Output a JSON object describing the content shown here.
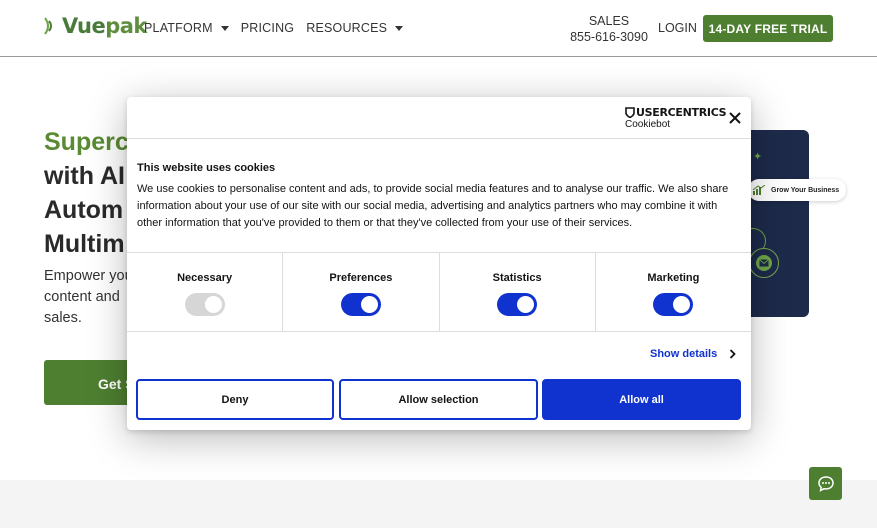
{
  "header": {
    "logo_text_vue": "Vue",
    "logo_text_pak": "pak",
    "nav": [
      {
        "label": "PLATFORM",
        "has_dropdown": true
      },
      {
        "label": "PRICING",
        "has_dropdown": false
      },
      {
        "label": "RESOURCES",
        "has_dropdown": true
      }
    ],
    "sales_label": "SALES",
    "sales_phone": "855-616-3090",
    "login_label": "LOGIN",
    "trial_label": "14-DAY FREE TRIAL"
  },
  "hero": {
    "title_line1": "Superc",
    "title_line2": "with AI",
    "title_line3": "Autom",
    "title_line4": "Multim",
    "sub_line1": "Empower you",
    "sub_line2": "content and",
    "sub_line3": "sales.",
    "cta_label": "Get S",
    "badge_label": "Grow Your Business"
  },
  "cookie_dialog": {
    "brand_top": "USERCENTRICS",
    "brand_sub": "Cookiebot",
    "heading": "This website uses cookies",
    "body": "We use cookies to personalise content and ads, to provide social media features and to analyse our traffic. We also share information about your use of our site with our social media, advertising and analytics partners who may combine it with other information that you've provided to them or that they've collected from your use of their services.",
    "categories": [
      {
        "label": "Necessary",
        "enabled": true,
        "locked": true
      },
      {
        "label": "Preferences",
        "enabled": true,
        "locked": false
      },
      {
        "label": "Statistics",
        "enabled": true,
        "locked": false
      },
      {
        "label": "Marketing",
        "enabled": true,
        "locked": false
      }
    ],
    "show_details": "Show details",
    "buttons": {
      "deny": "Deny",
      "allow_selection": "Allow selection",
      "allow_all": "Allow all"
    }
  },
  "colors": {
    "brand_green": "#4e7f31",
    "cookiebot_blue": "#1032cf",
    "card_navy": "#1d2a4a"
  }
}
